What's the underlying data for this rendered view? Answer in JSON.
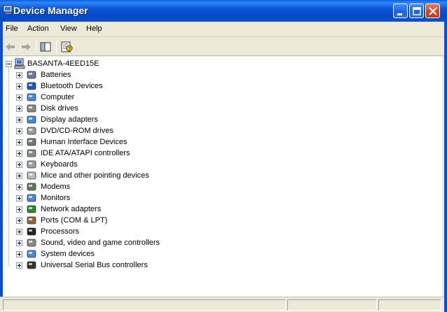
{
  "window": {
    "title": "Device Manager",
    "accent": "#0b4fd0"
  },
  "menu": [
    "File",
    "Action",
    "View",
    "Help"
  ],
  "toolbar": {
    "buttons": [
      "back-arrow-icon",
      "forward-arrow-icon",
      "show-hide-console-tree-icon",
      "properties-help-icon"
    ]
  },
  "tree": {
    "root": "BASANTA-4EED15E",
    "items": [
      {
        "label": "Batteries",
        "icon": "battery-icon"
      },
      {
        "label": "Bluetooth Devices",
        "icon": "bluetooth-icon"
      },
      {
        "label": "Computer",
        "icon": "computer-icon"
      },
      {
        "label": "Disk drives",
        "icon": "disk-drive-icon"
      },
      {
        "label": "Display adapters",
        "icon": "display-adapter-icon"
      },
      {
        "label": "DVD/CD-ROM drives",
        "icon": "cd-rom-icon"
      },
      {
        "label": "Human Interface Devices",
        "icon": "hid-icon"
      },
      {
        "label": "IDE ATA/ATAPI controllers",
        "icon": "ide-controller-icon"
      },
      {
        "label": "Keyboards",
        "icon": "keyboard-icon"
      },
      {
        "label": "Mice and other pointing devices",
        "icon": "mouse-icon"
      },
      {
        "label": "Modems",
        "icon": "modem-icon"
      },
      {
        "label": "Monitors",
        "icon": "monitor-icon"
      },
      {
        "label": "Network adapters",
        "icon": "network-adapter-icon"
      },
      {
        "label": "Ports (COM & LPT)",
        "icon": "port-icon"
      },
      {
        "label": "Processors",
        "icon": "processor-icon"
      },
      {
        "label": "Sound, video and game controllers",
        "icon": "sound-icon"
      },
      {
        "label": "System devices",
        "icon": "system-device-icon"
      },
      {
        "label": "Universal Serial Bus controllers",
        "icon": "usb-icon"
      }
    ]
  }
}
